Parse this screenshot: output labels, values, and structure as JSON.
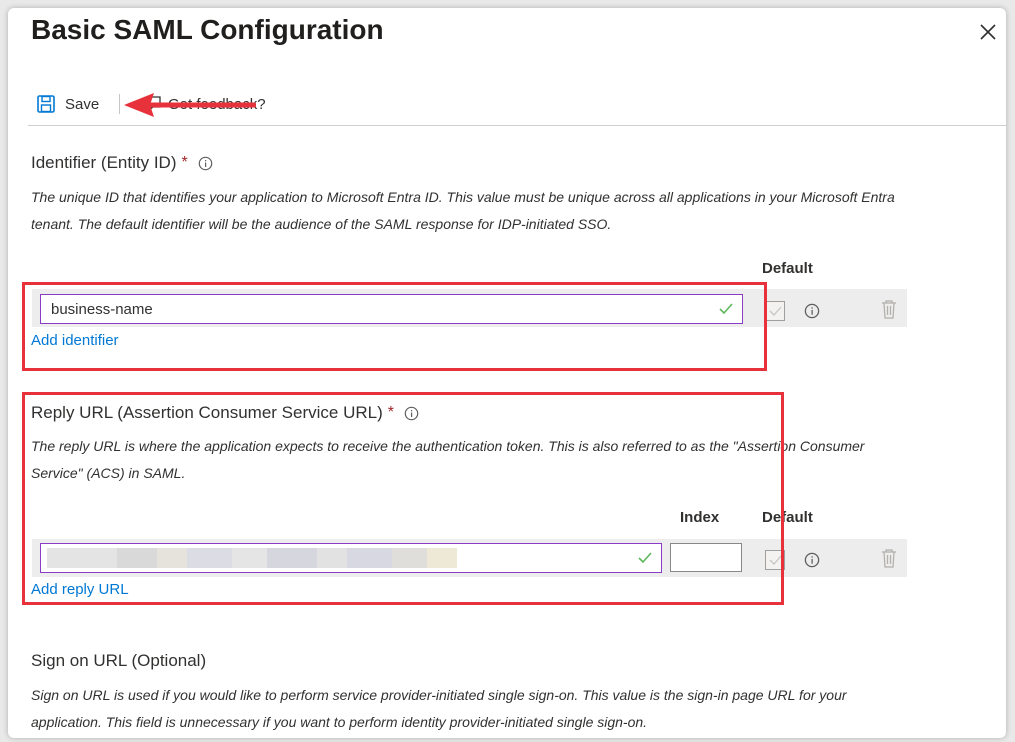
{
  "dialog": {
    "title": "Basic SAML Configuration",
    "close_icon": "close-icon"
  },
  "toolbar": {
    "save_label": "Save",
    "save_icon": "save-icon",
    "feedback_label": "Got feedback?",
    "feedback_icon": "feedback-icon"
  },
  "identifier": {
    "label": "Identifier (Entity ID)",
    "required_mark": "*",
    "description": "The unique ID that identifies your application to Microsoft Entra ID. This value must be unique across all applications in your Microsoft Entra tenant. The default identifier will be the audience of the SAML response for IDP-initiated SSO.",
    "default_header": "Default",
    "value": "business-name",
    "add_link": "Add identifier"
  },
  "reply_url": {
    "label": "Reply URL (Assertion Consumer Service URL)",
    "required_mark": "*",
    "description": "The reply URL is where the application expects to receive the authentication token. This is also referred to as the \"Assertion Consumer Service\" (ACS) in SAML.",
    "index_header": "Index",
    "default_header": "Default",
    "value": "",
    "index_value": "",
    "add_link": "Add reply URL"
  },
  "sign_on_url": {
    "label": "Sign on URL (Optional)",
    "description": "Sign on URL is used if you would like to perform service provider-initiated single sign-on. This value is the sign-in page URL for your application. This field is unnecessary if you want to perform identity provider-initiated single sign-on."
  },
  "colors": {
    "accent_link": "#0078d4",
    "input_border": "#8a3cc4",
    "annotation_red": "#e8323b",
    "valid_check": "#5db85c",
    "required": "#a4262c"
  }
}
